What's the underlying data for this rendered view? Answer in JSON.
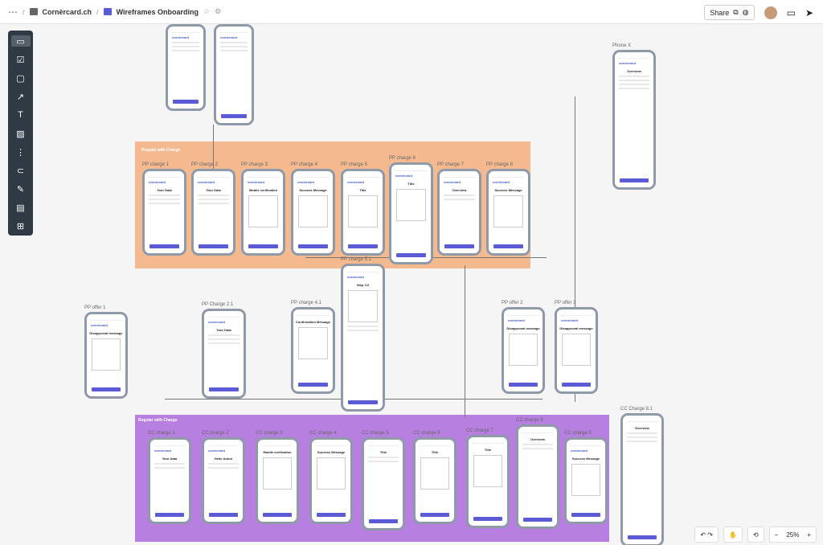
{
  "topbar": {
    "more": "⋯",
    "org": "Cornèrcard.ch",
    "board": "Wireframes Onboarding",
    "share_label": "Share"
  },
  "groups": {
    "prepaid": "Prepaid with Charge",
    "regular": "Regular with Charge"
  },
  "frames": {
    "phone_x": "Phone X",
    "pp1": "PP charge 1",
    "pp2": "PP charge 2",
    "pp3": "PP charge 3",
    "pp4": "PP charge 4",
    "pp5": "PP charge 5",
    "pp6": "PP charge 6",
    "pp7": "PP charge 7",
    "pp8": "PP charge 8",
    "pp51": "PP charge 5.1",
    "pp41": "PP charge 4.1",
    "ppoff1": "PP offer 1",
    "pp21": "PP Charge 2.1",
    "ppoff2": "PP offer 2",
    "ppoff3": "PP offer 3",
    "cc1": "CC charge 1",
    "cc2": "CC charge 2",
    "cc3": "CC charge 3",
    "cc4": "CC charge 4",
    "cc5": "CC charge 5",
    "cc6": "CC charge 6",
    "cc7": "CC charge 7",
    "cc8": "CC charge 8",
    "cc9": "CC charge 9",
    "cc81": "CC Charge 8.1"
  },
  "screens": {
    "your_data": "Your Data",
    "mobile_verification": "Mobile verification",
    "success": "Success Message",
    "title": "Title",
    "overview": "Overview",
    "confirmation": "Confirmation Message",
    "disapproval": "Disapproval message",
    "step": "Step 1/2",
    "hello": "Hello Anton"
  },
  "zoom": {
    "minus": "−",
    "value": "25%",
    "plus": "+"
  }
}
